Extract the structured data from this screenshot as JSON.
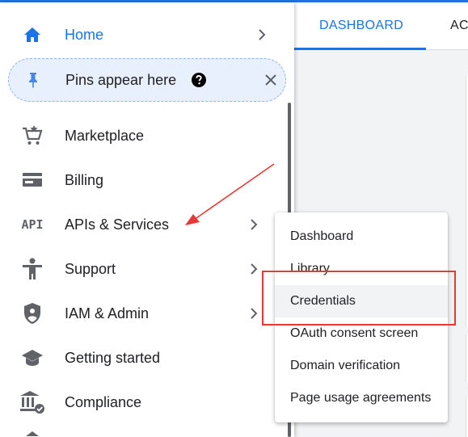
{
  "tabs": {
    "active": "DASHBOARD",
    "next": "AC"
  },
  "nav": {
    "home": "Home",
    "pins": "Pins appear here",
    "items": [
      {
        "label": "Marketplace",
        "icon": "marketplace-cart-icon"
      },
      {
        "label": "Billing",
        "icon": "billing-card-icon"
      },
      {
        "label": "APIs & Services",
        "icon": "api-icon"
      },
      {
        "label": "Support",
        "icon": "support-person-icon"
      },
      {
        "label": "IAM & Admin",
        "icon": "shield-icon"
      },
      {
        "label": "Getting started",
        "icon": "graduation-cap-icon"
      },
      {
        "label": "Compliance",
        "icon": "compliance-building-icon"
      }
    ]
  },
  "submenu": {
    "items": [
      "Dashboard",
      "Library",
      "Credentials",
      "OAuth consent screen",
      "Domain verification",
      "Page usage agreements"
    ],
    "highlighted": "Credentials"
  },
  "api_icon_text": "API",
  "colors": {
    "accent": "#1a73e8",
    "annotation": "#e53935",
    "icon": "#5f6368"
  }
}
